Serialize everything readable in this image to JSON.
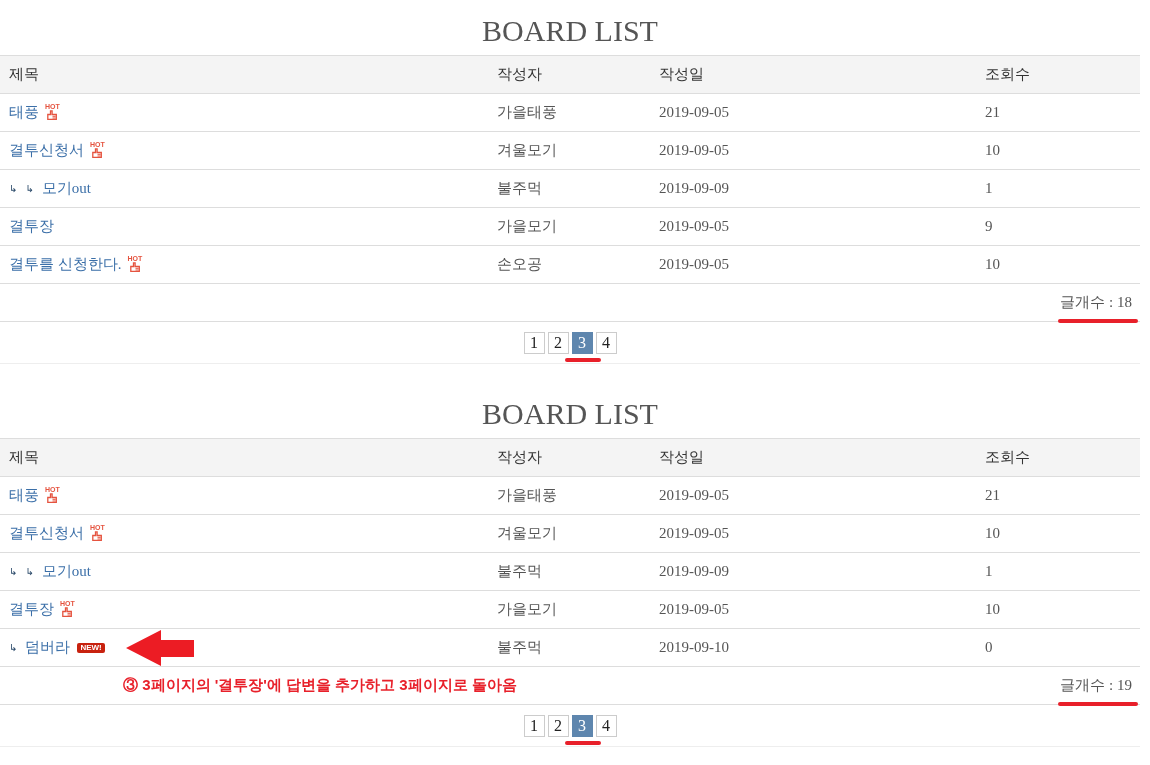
{
  "panels": [
    {
      "title": "BOARD LIST",
      "columns": [
        "제목",
        "작성자",
        "작성일",
        "조회수"
      ],
      "rows": [
        {
          "subject": {
            "text": "태풍",
            "badge": {
              "kind": "hot",
              "label": "HOT"
            }
          },
          "author": "가을태풍",
          "date": "2019-09-05",
          "views": "21",
          "arrow_marked": false
        },
        {
          "subject": {
            "text": "결투신청서",
            "badge": {
              "kind": "hot",
              "label": "HOT"
            }
          },
          "author": "겨울모기",
          "date": "2019-09-05",
          "views": "10",
          "arrow_marked": false
        },
        {
          "subject": {
            "reply_marks": [
              "↳",
              "↳"
            ],
            "text": "모기out"
          },
          "author": "불주먹",
          "date": "2019-09-09",
          "views": "1",
          "arrow_marked": false
        },
        {
          "subject": {
            "text": "결투장"
          },
          "author": "가을모기",
          "date": "2019-09-05",
          "views": "9",
          "arrow_marked": false
        },
        {
          "subject": {
            "text": "결투를 신청한다.",
            "badge": {
              "kind": "hot",
              "label": "HOT"
            }
          },
          "author": "손오공",
          "date": "2019-09-05",
          "views": "10",
          "arrow_marked": false
        }
      ],
      "count": {
        "text": "글개수 : 18",
        "underlined": true
      },
      "pages": [
        {
          "label": "1",
          "selected": false,
          "underlined": false
        },
        {
          "label": "2",
          "selected": false,
          "underlined": false
        },
        {
          "label": "3",
          "selected": true,
          "underlined": true
        },
        {
          "label": "4",
          "selected": false,
          "underlined": false
        }
      ]
    },
    {
      "title": "BOARD LIST",
      "columns": [
        "제목",
        "작성자",
        "작성일",
        "조회수"
      ],
      "rows": [
        {
          "subject": {
            "text": "태풍",
            "badge": {
              "kind": "hot",
              "label": "HOT"
            }
          },
          "author": "가을태풍",
          "date": "2019-09-05",
          "views": "21",
          "arrow_marked": false
        },
        {
          "subject": {
            "text": "결투신청서",
            "badge": {
              "kind": "hot",
              "label": "HOT"
            }
          },
          "author": "겨울모기",
          "date": "2019-09-05",
          "views": "10",
          "arrow_marked": false
        },
        {
          "subject": {
            "reply_marks": [
              "↳",
              "↳"
            ],
            "text": "모기out"
          },
          "author": "불주먹",
          "date": "2019-09-09",
          "views": "1",
          "arrow_marked": false
        },
        {
          "subject": {
            "text": "결투장",
            "badge": {
              "kind": "hot",
              "label": "HOT"
            }
          },
          "author": "가을모기",
          "date": "2019-09-05",
          "views": "10",
          "arrow_marked": false
        },
        {
          "subject": {
            "reply_marks": [
              "↳"
            ],
            "text": "덤버라",
            "badge": {
              "kind": "new",
              "label": "NEW!"
            }
          },
          "author": "불주먹",
          "date": "2019-09-10",
          "views": "0",
          "arrow_marked": true
        }
      ],
      "note": "③ 3페이지의 '결투장'에 답변을 추가하고 3페이지로 돌아옴",
      "count": {
        "text": "글개수 : 19",
        "underlined": true
      },
      "pages": [
        {
          "label": "1",
          "selected": false,
          "underlined": false
        },
        {
          "label": "2",
          "selected": false,
          "underlined": false
        },
        {
          "label": "3",
          "selected": true,
          "underlined": true
        },
        {
          "label": "4",
          "selected": false,
          "underlined": false
        }
      ]
    }
  ]
}
